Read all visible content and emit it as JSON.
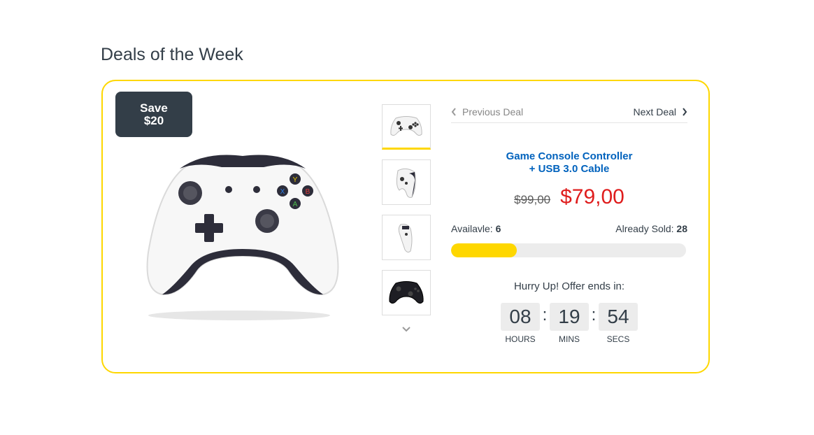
{
  "section": {
    "title": "Deals of the Week"
  },
  "deal": {
    "badge": {
      "line1": "Save",
      "line2": "$20"
    },
    "nav": {
      "previous": "Previous Deal",
      "next": "Next Deal"
    },
    "product": {
      "name_line1": "Game Console Controller",
      "name_line2": "+ USB 3.0 Cable"
    },
    "price": {
      "old": "$99,00",
      "new": "$79,00"
    },
    "stock": {
      "available_label": "Availavle:",
      "available_value": "6",
      "sold_label": "Already Sold:",
      "sold_value": "28",
      "sold_fraction": 0.28
    },
    "countdown": {
      "title": "Hurry Up! Offer ends in:",
      "hours": "08",
      "hours_label": "HOURS",
      "mins": "19",
      "mins_label": "MINS",
      "secs": "54",
      "secs_label": "SECS"
    },
    "thumbnails": [
      {
        "icon": "white-controller-front-thumbnail",
        "active": true
      },
      {
        "icon": "white-controller-side-thumbnail",
        "active": false
      },
      {
        "icon": "white-controller-edge-thumbnail",
        "active": false
      },
      {
        "icon": "black-controller-thumbnail",
        "active": false
      }
    ]
  },
  "colors": {
    "accent": "#fed700",
    "badge_bg": "#333e48",
    "product_link": "#0062bd",
    "sale_price": "#df1d1d"
  }
}
